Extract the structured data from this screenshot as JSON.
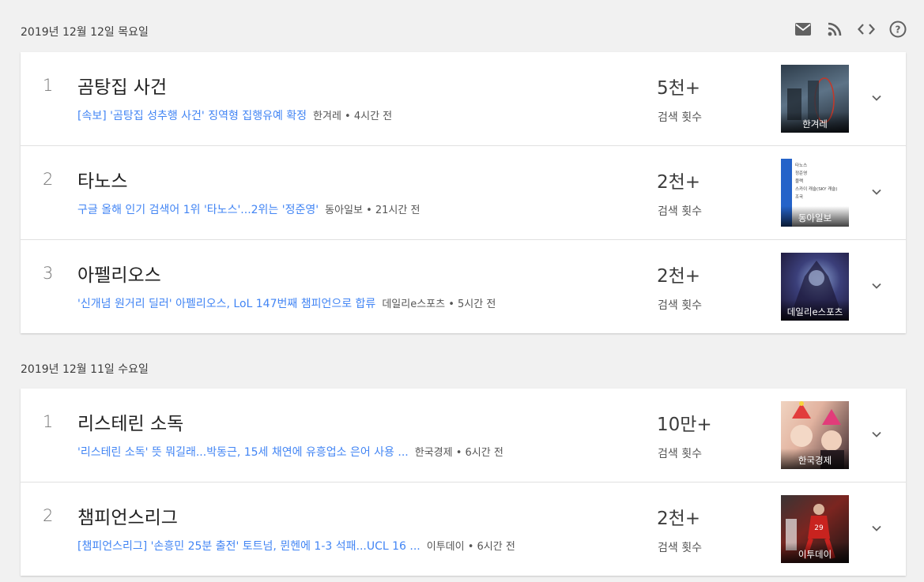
{
  "toolbar": {
    "icons": [
      "mail-icon",
      "rss-icon",
      "embed-code-icon",
      "help-icon"
    ]
  },
  "days": [
    {
      "date": "2019년 12월 12일 목요일",
      "items": [
        {
          "rank": "1",
          "title": "곰탕집 사건",
          "article": "[속보] '곰탕집 성추행 사건' 징역형 집행유예 확정",
          "source": "한겨레 • 4시간 전",
          "count": "5천+",
          "count_label": "검색 횟수",
          "thumb_caption": "한겨레"
        },
        {
          "rank": "2",
          "title": "타노스",
          "article": "구글 올해 인기 검색어 1위 '타노스'...2위는 '정준영'",
          "source": "동아일보 • 21시간 전",
          "count": "2천+",
          "count_label": "검색 횟수",
          "thumb_caption": "동아일보",
          "thumb_list": [
            "타노스",
            "정준영",
            "블랙",
            "스카이 캐슬(SKY 캐슬)",
            "조국"
          ]
        },
        {
          "rank": "3",
          "title": "아펠리오스",
          "article": "'신개념 원거리 딜러' 아펠리오스, LoL 147번째 챔피언으로 합류",
          "source": "데일리e스포츠 • 5시간 전",
          "count": "2천+",
          "count_label": "검색 횟수",
          "thumb_caption": "데일리e스포츠"
        }
      ]
    },
    {
      "date": "2019년 12월 11일 수요일",
      "items": [
        {
          "rank": "1",
          "title": "리스테린 소독",
          "article": "'리스테린 소독' 뜻 뭐길래...박동근, 15세 채연에 유흥업소 은어 사용 ...",
          "source": "한국경제 • 6시간 전",
          "count": "10만+",
          "count_label": "검색 횟수",
          "thumb_caption": "한국경제"
        },
        {
          "rank": "2",
          "title": "챔피언스리그",
          "article": "[챔피언스리그] '손흥민 25분 출전' 토트넘, 뮌헨에 1-3 석패...UCL 16 ...",
          "source": "이투데이 • 6시간 전",
          "count": "2천+",
          "count_label": "검색 횟수",
          "thumb_caption": "이투데이"
        }
      ]
    }
  ],
  "colors": {
    "background": "#f1f1f1",
    "link": "#4285f4",
    "card": "#ffffff"
  }
}
